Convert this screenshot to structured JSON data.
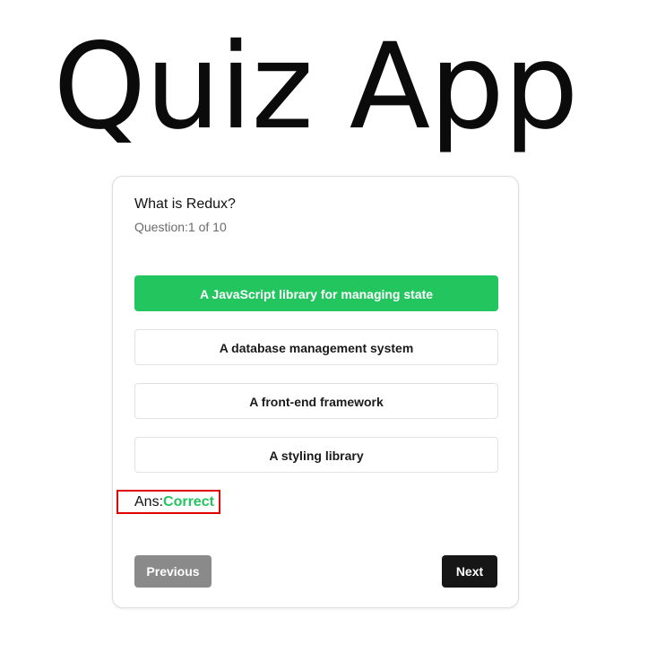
{
  "app": {
    "title": "Quiz App"
  },
  "quiz": {
    "question": "What is Redux?",
    "counter": "Question:1 of 10",
    "options": [
      {
        "label": "A JavaScript library for managing state",
        "state": "selected-correct"
      },
      {
        "label": "A database management system",
        "state": "default"
      },
      {
        "label": "A front-end framework",
        "state": "default"
      },
      {
        "label": "A styling library",
        "state": "default"
      }
    ],
    "answer": {
      "prefix": "Ans:",
      "result": "Correct"
    },
    "buttons": {
      "previous": "Previous",
      "next": "Next"
    }
  },
  "colors": {
    "correct": "#22c55e",
    "highlight_box": "#e00000",
    "next_button": "#161616",
    "previous_button": "#8a8a8a"
  }
}
